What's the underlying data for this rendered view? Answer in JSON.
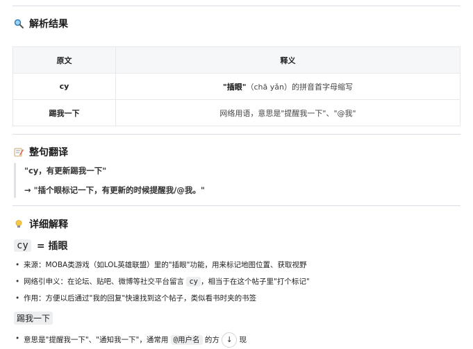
{
  "sections": {
    "analysis": {
      "icon": "magnifier-icon",
      "title": "解析结果"
    },
    "translation": {
      "icon": "memo-icon",
      "title": "整句翻译"
    },
    "explanation": {
      "icon": "lightbulb-icon",
      "title": "详细解释"
    }
  },
  "table": {
    "headers": [
      "原文",
      "释义"
    ],
    "rows": [
      {
        "term": "cy",
        "meaning_bold": "\"插眼\"",
        "meaning_rest": "（chā yǎn）的拼音首字母缩写"
      },
      {
        "term": "踢我一下",
        "meaning_bold": "",
        "meaning_rest": "网络用语，意思是\"提醒我一下\"、\"@我\""
      }
    ]
  },
  "quote": {
    "line1": "\"cy，有更新踢我一下\"",
    "line2": "→ \"插个眼标记一下，有更新的时候提醒我/@我。\""
  },
  "definition": {
    "code": "cy",
    "equals": "= 插眼"
  },
  "bullets1": [
    {
      "text1": "来源：MOBA类游戏（如LOL英雄联盟）里的\"插眼\"功能，用来标记地图位置、获取视野",
      "code": "",
      "text2": ""
    },
    {
      "text1": "网络引申义：在论坛、贴吧、微博等社交平台留言",
      "code": "cy",
      "text2": "，相当于在这个帖子里\"打个标记\""
    },
    {
      "text1": "作用：方便以后通过\"我的回复\"快速找到这个帖子，类似看书时夹的书签",
      "code": "",
      "text2": ""
    }
  ],
  "subterm": "踢我一下",
  "bullets2": [
    {
      "text1": "意思是\"提醒我一下\"、\"通知我一下\"，通常用",
      "code": "@用户名",
      "text2": "的方",
      "tail": "现"
    }
  ],
  "scroll_button": {
    "icon": "arrow-down-icon",
    "glyph": "↓"
  },
  "colors": {
    "border": "#d9dde3",
    "header_bg": "#f6f7f8",
    "code_bg": "#eceef0"
  }
}
